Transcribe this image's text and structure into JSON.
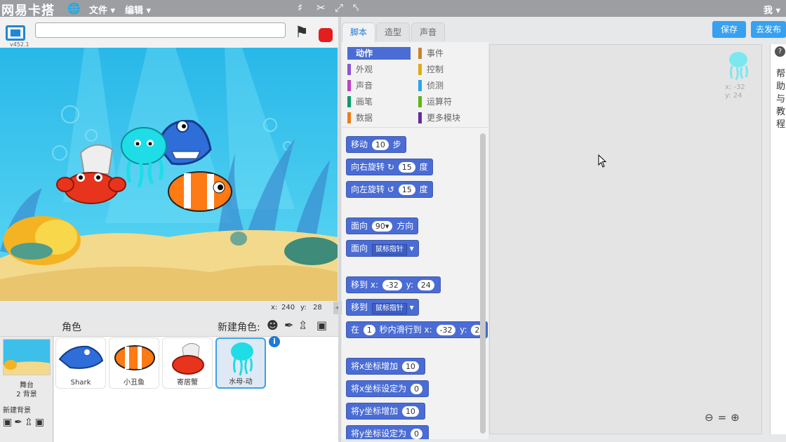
{
  "menubar": {
    "logo": "网易卡搭",
    "file": "文件",
    "edit": "编辑",
    "user": "我"
  },
  "stage": {
    "version": "v452.1",
    "x_label": "x:",
    "x_value": "240",
    "y_label": "y:",
    "y_value": "28"
  },
  "sprites_panel": {
    "title": "角色",
    "new_sprite": "新建角色:",
    "stage_label": "舞台",
    "stage_backdrops": "2 背景",
    "new_backdrop": "新建背景",
    "sprites": [
      {
        "name": "Shark"
      },
      {
        "name": "小丑鱼"
      },
      {
        "name": "寄居蟹"
      },
      {
        "name": "水母-动"
      }
    ],
    "selected": "水母-动"
  },
  "tabs": {
    "scripts": "脚本",
    "costumes": "造型",
    "sounds": "声音"
  },
  "buttons": {
    "save": "保存",
    "publish": "去发布"
  },
  "categories": [
    {
      "label": "动作",
      "color": "#4a6cd4",
      "active": true
    },
    {
      "label": "事件",
      "color": "#c88330"
    },
    {
      "label": "外观",
      "color": "#8a55d7"
    },
    {
      "label": "控制",
      "color": "#e1a91a"
    },
    {
      "label": "声音",
      "color": "#bb42c3"
    },
    {
      "label": "侦测",
      "color": "#2ca5e2"
    },
    {
      "label": "画笔",
      "color": "#0e9a6c"
    },
    {
      "label": "运算符",
      "color": "#5cb712"
    },
    {
      "label": "数据",
      "color": "#ee7d16"
    },
    {
      "label": "更多模块",
      "color": "#632d99"
    }
  ],
  "blocks": {
    "move": {
      "pre": "移动",
      "val": "10",
      "post": "步"
    },
    "turn_right": {
      "pre": "向右旋转",
      "val": "15",
      "post": "度"
    },
    "turn_left": {
      "pre": "向左旋转",
      "val": "15",
      "post": "度"
    },
    "point_dir": {
      "pre": "面向",
      "val": "90▾",
      "post": "方向"
    },
    "point_towards": {
      "pre": "面向",
      "dd": "鼠标指针"
    },
    "goto_xy": {
      "pre": "移到",
      "x": "x:",
      "xval": "-32",
      "y": "y:",
      "yval": "24"
    },
    "goto": {
      "pre": "移到",
      "dd": "鼠标指针"
    },
    "glide": {
      "pre": "在",
      "secs": "1",
      "mid": "秒内滑行到",
      "x": "x:",
      "xval": "-32",
      "y": "y:",
      "yval": "2"
    },
    "change_x": {
      "pre": "将x坐标增加",
      "val": "10"
    },
    "set_x": {
      "pre": "将x坐标设定为",
      "val": "0"
    },
    "change_y": {
      "pre": "将y坐标增加",
      "val": "10"
    },
    "set_y": {
      "pre": "将y坐标设定为",
      "val": "0"
    }
  },
  "scripts_area": {
    "sprite_x": "x: -32",
    "sprite_y": "y: 24"
  },
  "help": {
    "text": "帮助与教程"
  }
}
